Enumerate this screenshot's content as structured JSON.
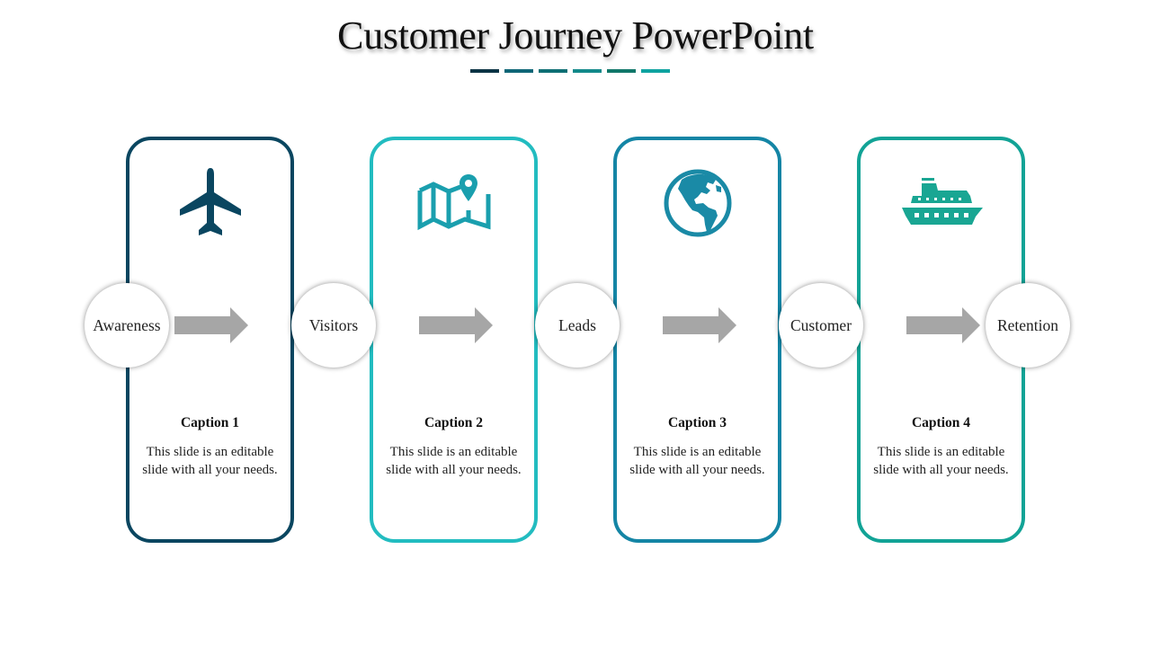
{
  "title": "Customer Journey PowerPoint",
  "title_dashes": [
    "#0b3344",
    "#0f6677",
    "#0e6f74",
    "#12898a",
    "#11776a",
    "#0fa3a0"
  ],
  "stages": [
    {
      "label": "Awareness"
    },
    {
      "label": "Visitors"
    },
    {
      "label": "Leads"
    },
    {
      "label": "Customer"
    },
    {
      "label": "Retention"
    }
  ],
  "cards": [
    {
      "icon": "airplane-icon",
      "color": "#0a4660",
      "caption": "Caption 1",
      "body": "This slide is an editable slide with all your needs."
    },
    {
      "icon": "map-pin-icon",
      "color": "#22bcc0",
      "caption": "Caption 2",
      "body": "This slide is an editable slide with all your needs."
    },
    {
      "icon": "globe-icon",
      "color": "#1485a5",
      "caption": "Caption 3",
      "body": "This slide is an editable slide with all your needs."
    },
    {
      "icon": "ship-icon",
      "color": "#12a396",
      "caption": "Caption 4",
      "body": "This slide is an editable slide with all your needs."
    }
  ],
  "arrow_color": "#a6a6a6",
  "icon_colors": {
    "airplane": "#0a4660",
    "map": "#1a9fae",
    "globe": "#1a8aa6",
    "ship": "#19a693"
  }
}
